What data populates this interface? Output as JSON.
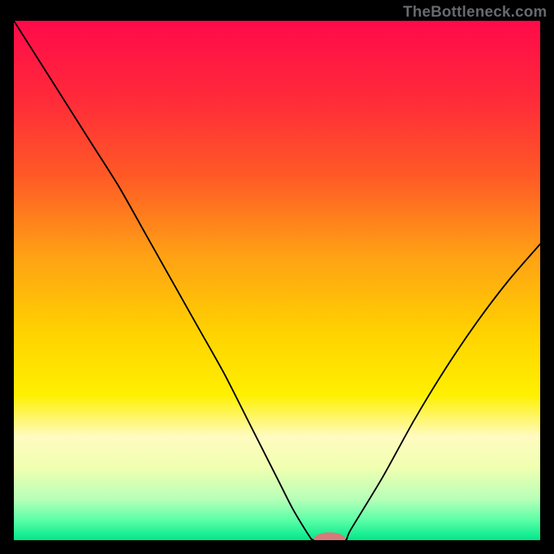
{
  "watermark": "TheBottleneck.com",
  "chart_data": {
    "type": "line",
    "title": "",
    "xlabel": "",
    "ylabel": "",
    "xlim": [
      0,
      100
    ],
    "ylim": [
      0,
      100
    ],
    "grid": false,
    "legend": false,
    "gradient_stops": [
      {
        "offset": 0.0,
        "color": "#ff0a4a"
      },
      {
        "offset": 0.15,
        "color": "#ff2a3a"
      },
      {
        "offset": 0.3,
        "color": "#ff5a25"
      },
      {
        "offset": 0.45,
        "color": "#ffa015"
      },
      {
        "offset": 0.6,
        "color": "#ffd200"
      },
      {
        "offset": 0.72,
        "color": "#fff000"
      },
      {
        "offset": 0.8,
        "color": "#fffbc0"
      },
      {
        "offset": 0.86,
        "color": "#f0ffb0"
      },
      {
        "offset": 0.92,
        "color": "#b8ffb8"
      },
      {
        "offset": 0.96,
        "color": "#5effa8"
      },
      {
        "offset": 1.0,
        "color": "#00e88a"
      }
    ],
    "series": [
      {
        "name": "curve",
        "color": "#000000",
        "x": [
          0,
          5,
          10,
          15,
          20,
          25,
          30,
          35,
          40,
          45,
          50,
          53,
          56,
          57,
          60,
          63,
          64,
          70,
          76,
          82,
          88,
          94,
          100
        ],
        "y": [
          100,
          92,
          84,
          76,
          68,
          59,
          50,
          41,
          32,
          22,
          12,
          6,
          1,
          0,
          0,
          0,
          2,
          12,
          23,
          33,
          42,
          50,
          57
        ]
      }
    ],
    "marker": {
      "name": "min-marker",
      "x": 60,
      "y": 0.2,
      "color": "#d77a7a",
      "rx": 3.0,
      "ry": 1.3
    }
  }
}
